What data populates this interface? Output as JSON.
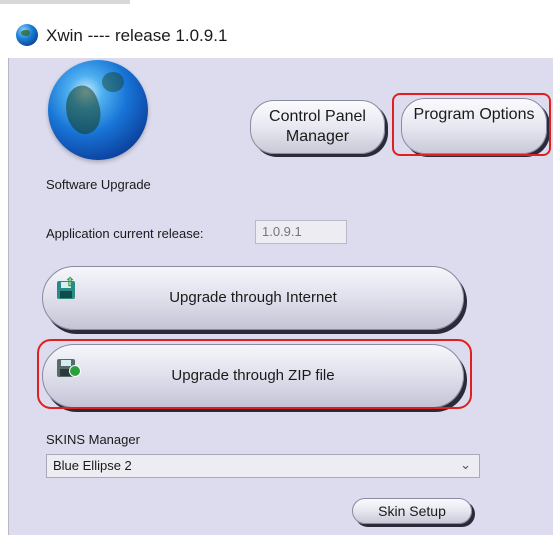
{
  "window": {
    "title": "Xwin ---- release 1.0.9.1"
  },
  "tabs": {
    "control_panel_manager": "Control Panel Manager",
    "program_options": "Program Options"
  },
  "software_upgrade": {
    "section_label": "Software Upgrade",
    "current_release_label": "Application current release:",
    "current_release_value": "1.0.9.1",
    "internet_button": "Upgrade through Internet",
    "zip_button": "Upgrade through ZIP file"
  },
  "skins": {
    "section_label": "SKINS Manager",
    "selected": "Blue Ellipse 2",
    "setup_button": "Skin Setup"
  },
  "colors": {
    "panel_bg": "#dcdcee",
    "highlight": "#e0201f"
  }
}
